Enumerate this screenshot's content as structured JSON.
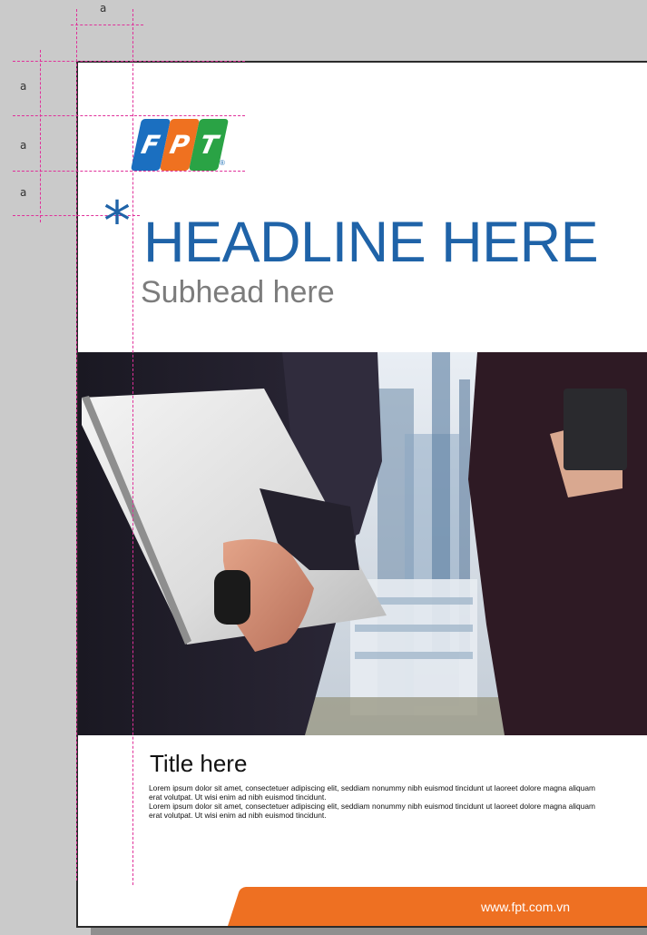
{
  "guides": {
    "label": "a"
  },
  "logo": {
    "letters": [
      "F",
      "P",
      "T"
    ],
    "colors": [
      "#1b6fc0",
      "#ef7120",
      "#2aa345"
    ],
    "registered": "®"
  },
  "hero": {
    "asterisk": "*",
    "headline": "HEADLINE HERE",
    "subhead": "Subhead here",
    "headline_color": "#1f63a8",
    "subhead_color": "#7c7c7c"
  },
  "content": {
    "title": "Title here",
    "paragraphs": [
      "Lorem ipsum dolor sit amet, consectetuer adipiscing elit, seddiam nonummy nibh euismod tincidunt ut laoreet dolore magna aliquam erat volutpat. Ut wisi enim ad nibh euismod tincidunt.",
      "Lorem ipsum dolor sit amet, consectetuer adipiscing elit, seddiam nonummy nibh euismod tincidunt ut laoreet dolore magna aliquam erat volutpat. Ut wisi enim ad nibh euismod tincidunt."
    ]
  },
  "footer": {
    "url": "www.fpt.com.vn",
    "band_color": "#ee7022"
  },
  "photo": {
    "icon": "business-people-photo"
  }
}
